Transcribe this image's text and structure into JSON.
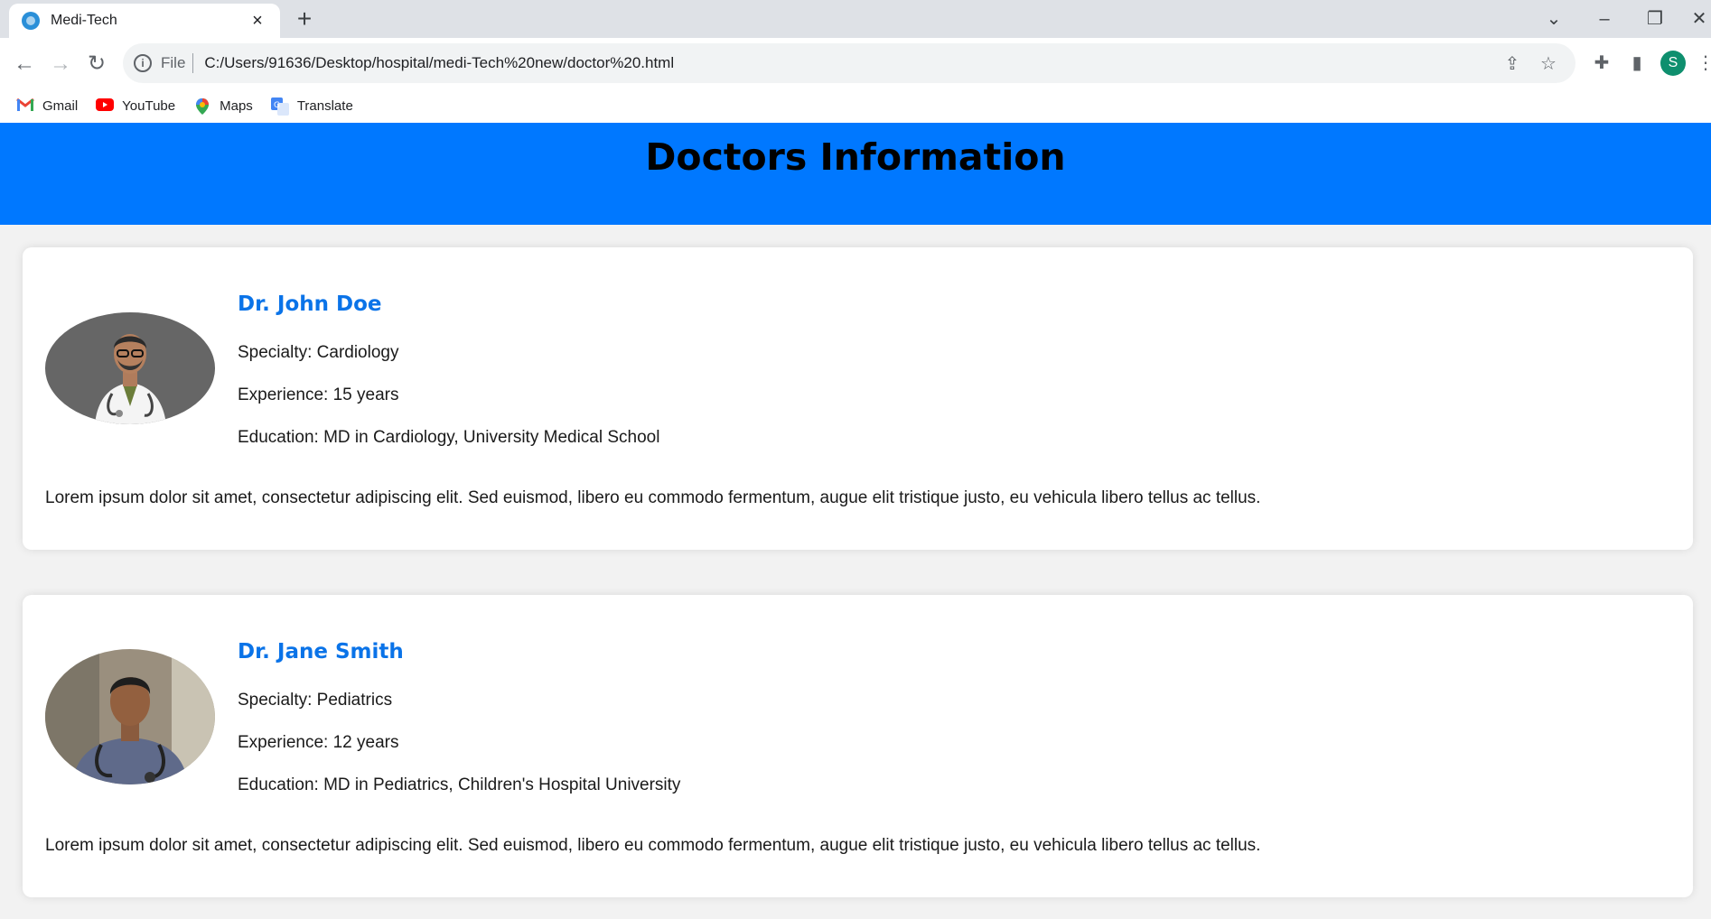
{
  "browser": {
    "tab_title": "Medi-Tech",
    "tab_close": "×",
    "new_tab": "+",
    "file_label": "File",
    "url": "C:/Users/91636/Desktop/hospital/medi-Tech%20new/doctor%20.html",
    "profile_initial": "S",
    "bookmarks": [
      {
        "label": "Gmail",
        "icon": "gmail-icon"
      },
      {
        "label": "YouTube",
        "icon": "youtube-icon"
      },
      {
        "label": "Maps",
        "icon": "maps-icon"
      },
      {
        "label": "Translate",
        "icon": "translate-icon"
      }
    ]
  },
  "page": {
    "title": "Doctors Information",
    "header_color": "#0078ff",
    "name_color": "#0a73e8"
  },
  "doctors": [
    {
      "name": "Dr. John Doe",
      "specialty": "Specialty: Cardiology",
      "experience": "Experience: 15 years",
      "education": "Education: MD in Cardiology, University Medical School",
      "bio": "Lorem ipsum dolor sit amet, consectetur adipiscing elit. Sed euismod, libero eu commodo fermentum, augue elit tristique justo, eu vehicula libero tellus ac tellus."
    },
    {
      "name": "Dr. Jane Smith",
      "specialty": "Specialty: Pediatrics",
      "experience": "Experience: 12 years",
      "education": "Education: MD in Pediatrics, Children's Hospital University",
      "bio": "Lorem ipsum dolor sit amet, consectetur adipiscing elit. Sed euismod, libero eu commodo fermentum, augue elit tristique justo, eu vehicula libero tellus ac tellus."
    }
  ]
}
